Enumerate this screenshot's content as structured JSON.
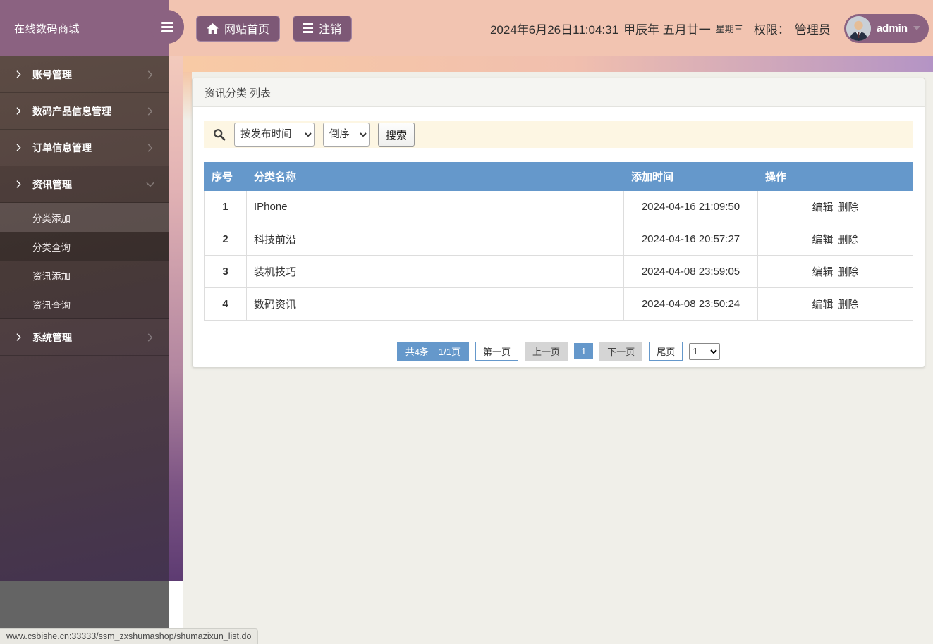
{
  "app": {
    "logo_title": "在线数码商城"
  },
  "topbar": {
    "home_label": "网站首页",
    "logout_label": "注销",
    "datetime": "2024年6月26日11:04:31",
    "lunar": "甲辰年 五月廿一",
    "weekday": "星期三",
    "role_label": "权限：",
    "role_value": "管理员",
    "username": "admin"
  },
  "sidebar": {
    "items": [
      {
        "label": "账号管理",
        "expanded": false
      },
      {
        "label": "数码产品信息管理",
        "expanded": false
      },
      {
        "label": "订单信息管理",
        "expanded": false
      },
      {
        "label": "资讯管理",
        "expanded": true,
        "children": [
          "分类添加",
          "分类查询",
          "资讯添加",
          "资讯查询"
        ]
      },
      {
        "label": "系统管理",
        "expanded": false
      }
    ]
  },
  "main": {
    "panel_title": "资讯分类 列表",
    "search": {
      "field_option": "按发布时间",
      "order_option": "倒序",
      "button_label": "搜索"
    },
    "table": {
      "headers": [
        "序号",
        "分类名称",
        "添加时间",
        "操作"
      ],
      "rows": [
        {
          "no": "1",
          "name": "IPhone",
          "time": "2024-04-16 21:09:50"
        },
        {
          "no": "2",
          "name": "科技前沿",
          "time": "2024-04-16 20:57:27"
        },
        {
          "no": "3",
          "name": "装机技巧",
          "time": "2024-04-08 23:59:05"
        },
        {
          "no": "4",
          "name": "数码资讯",
          "time": "2024-04-08 23:50:24"
        }
      ],
      "actions": {
        "edit": "编辑",
        "delete": "删除"
      }
    },
    "pagination": {
      "total": "共4条",
      "page_info": "1/1页",
      "first": "第一页",
      "prev": "上一页",
      "current": "1",
      "next": "下一页",
      "last": "尾页",
      "page_select_value": "1"
    }
  },
  "statusbar": {
    "url": "www.csbishe.cn:33333/ssm_zxshumashop/shumazixun_list.do"
  },
  "icons": {
    "hamburger": "≡",
    "home": "⌂",
    "logout_list": "≡",
    "search": "🔍",
    "chevron_right": "❯",
    "chevron_down": "⌄",
    "caret_down": "▾"
  },
  "colors": {
    "brand_purple": "#8b6281",
    "button_purple": "#7d5876",
    "topbar_salmon": "#f2c4b1",
    "accent_blue": "#6598cb",
    "search_bg": "#fdf6e3",
    "band_lavender": "#b494c5",
    "sidebar_bottom_gray": "#646464"
  }
}
